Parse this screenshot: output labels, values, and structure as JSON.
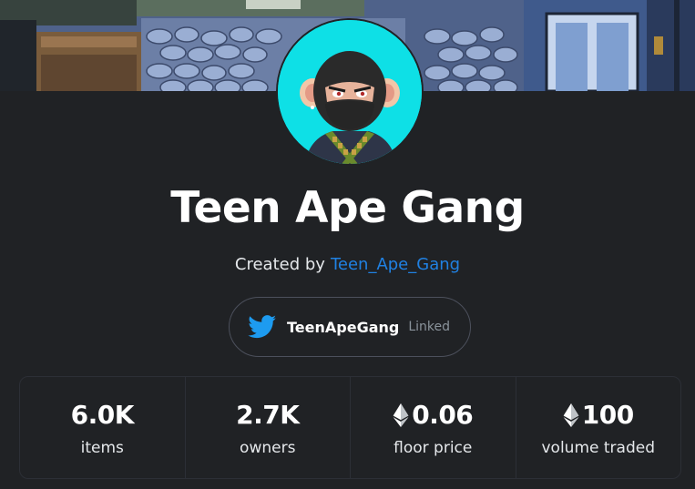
{
  "collection": {
    "name": "Teen Ape Gang",
    "created_by_prefix": "Created by",
    "creator": "Teen_Ape_Gang"
  },
  "social": {
    "icon": "twitter-icon",
    "handle": "TeenApeGang",
    "status": "Linked"
  },
  "stats": [
    {
      "value": "6.0K",
      "label": "items",
      "icon": null
    },
    {
      "value": "2.7K",
      "label": "owners",
      "icon": null
    },
    {
      "value": "0.06",
      "label": "floor price",
      "icon": "ethereum-icon"
    },
    {
      "value": "100",
      "label": "volume traded",
      "icon": "ethereum-icon"
    }
  ],
  "colors": {
    "background": "#202225",
    "link": "#2081e2",
    "twitter": "#1d9bf0",
    "avatar_bg": "#0ee0e6",
    "muted": "#8a939b",
    "border": "#2c2f36"
  }
}
